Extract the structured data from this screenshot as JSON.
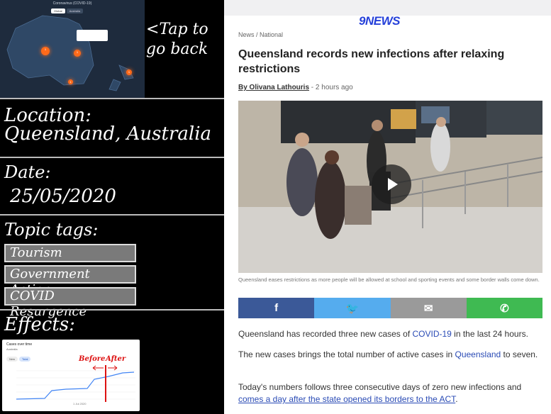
{
  "left": {
    "map": {
      "title": "Coronavirus (COVID-19)",
      "tabs": [
        "Global",
        "Australia"
      ],
      "hotspots": [
        "1",
        "1",
        "1",
        "1"
      ]
    },
    "tap_back": "<Tap to go back",
    "location_label": "Location:",
    "location_value": "Queensland, Australia",
    "date_label": "Date:",
    "date_value": "25/05/2020",
    "topic_label": "Topic tags:",
    "tags": [
      "Tourism",
      "Government Action",
      "COVID Resurgence"
    ],
    "effects_label": "Effects:",
    "effects_chart": {
      "title": "Cases over time",
      "subtitle": "Australia",
      "toggles": [
        "New",
        "Total"
      ],
      "before_label": "Before",
      "after_label": "After",
      "x_ticks": [
        "1 Jul 2020"
      ],
      "footer": "",
      "accent": "#4285f4",
      "marker_color": "#dd1111"
    }
  },
  "right": {
    "logo": "9NEWS",
    "breadcrumb": "News / National",
    "headline": "Queensland records new infections after relaxing restrictions",
    "byline_author": "By Olivana Lathouris",
    "byline_time": " - 2 hours ago",
    "caption": "Queensland eases restrictions as more people will be allowed at school and sporting events and some border walls come down.",
    "share": [
      {
        "name": "facebook",
        "glyph": "f",
        "color": "#3b5998"
      },
      {
        "name": "twitter",
        "glyph": "🐦",
        "color": "#55acee"
      },
      {
        "name": "email",
        "glyph": "✉",
        "color": "#9a9a9a"
      },
      {
        "name": "whatsapp",
        "glyph": "✆",
        "color": "#3fba52"
      }
    ],
    "para1_pre": "Queensland has recorded three new cases of ",
    "para1_link": "COVID-19",
    "para1_post": " in the last 24 hours.",
    "para2_pre": "The new cases brings the total number of active cases in ",
    "para2_link": "Queensland",
    "para2_post": " to seven.",
    "para3_pre": "Today's numbers follows three consecutive days of zero new infections and ",
    "para3_link": "comes a day after the state opened its borders to the ACT",
    "para3_post": "."
  }
}
